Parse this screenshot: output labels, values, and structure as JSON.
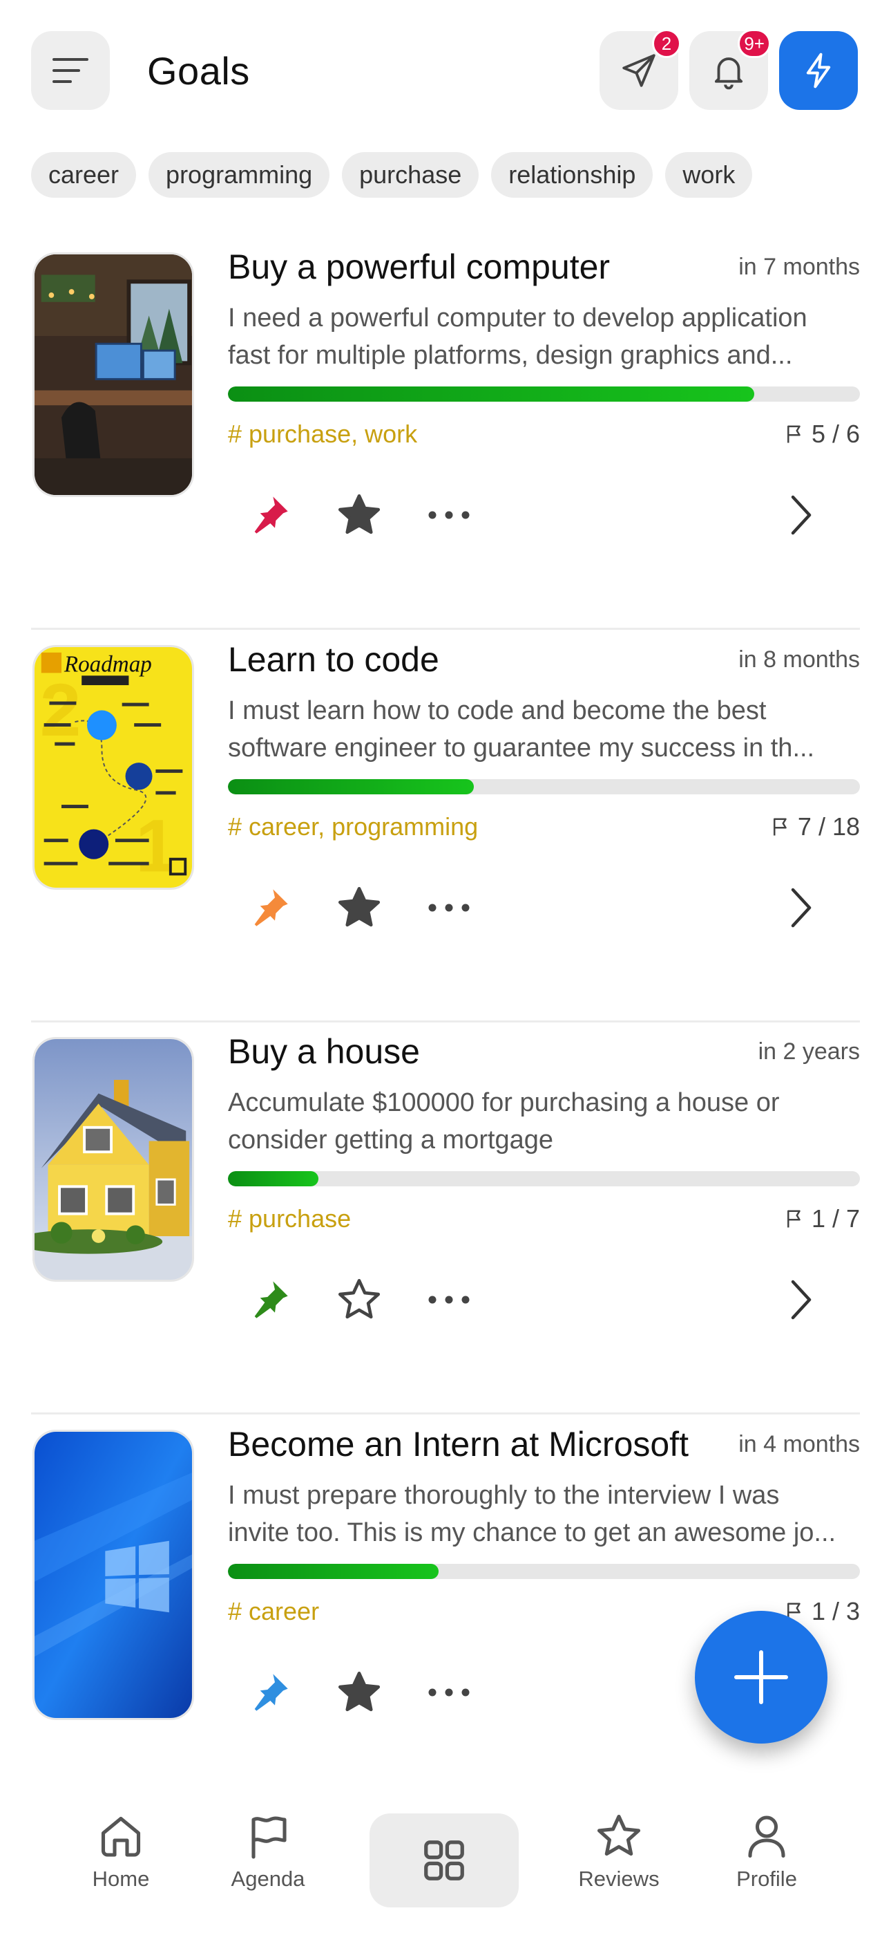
{
  "header": {
    "title": "Goals",
    "messages_badge": "2",
    "notifications_badge": "9+"
  },
  "filters": [
    "career",
    "programming",
    "purchase",
    "relationship",
    "work"
  ],
  "colors": {
    "accent": "#1c74e8",
    "badge": "#e0124a",
    "progress": "#17c41c",
    "tag": "#c8a010"
  },
  "goals": [
    {
      "title": "Buy a powerful computer",
      "due": "in 7 months",
      "desc_line1": "I need a powerful computer to develop application",
      "desc_line2": "fast for multiple platforms, design graphics and...",
      "progress": 0.833,
      "tags": "# purchase, work",
      "steps": "5 / 6",
      "pin_color": "#d81b4a",
      "starred": true
    },
    {
      "title": "Learn to code",
      "due": "in 8 months",
      "desc_line1": "I must learn how to code and become the best",
      "desc_line2": "software engineer to guarantee my success in th...",
      "progress": 0.389,
      "tags": "# career, programming",
      "steps": "7 / 18",
      "pin_color": "#f58a3a",
      "starred": true,
      "thumb_text": "Roadmap"
    },
    {
      "title": "Buy a house",
      "due": "in 2 years",
      "desc_line1": "Accumulate $100000 for purchasing a house or",
      "desc_line2": "consider getting a mortgage",
      "progress": 0.143,
      "tags": "# purchase",
      "steps": "1 / 7",
      "pin_color": "#2e8b1a",
      "starred": false
    },
    {
      "title": "Become an Intern at Microsoft",
      "due": "in 4 months",
      "desc_line1": "I must prepare thoroughly to the interview I was",
      "desc_line2": "invite too. This is my chance to get an awesome jo...",
      "progress": 0.333,
      "tags": "# career",
      "steps": "1 / 3",
      "pin_color": "#2f8fe0",
      "starred": true
    }
  ],
  "nav": {
    "home": "Home",
    "agenda": "Agenda",
    "reviews": "Reviews",
    "profile": "Profile"
  }
}
